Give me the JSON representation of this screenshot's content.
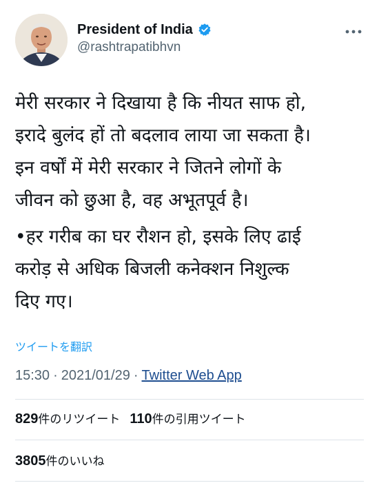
{
  "author": {
    "display_name": "President of India",
    "handle": "@rashtrapatibhvn",
    "avatar_icon": "portrait-avatar",
    "verified_icon": "verified-badge-icon",
    "verified_color": "#1d9bf0"
  },
  "menu": {
    "icon": "more-horizontal-icon"
  },
  "tweet": {
    "paragraphs": [
      "मेरी सरकार ने दिखाया है कि नीयत साफ हो,\nइरादे बुलंद हों तो बदलाव लाया जा सकता है।\nइन वर्षों में मेरी सरकार ने जितने लोगों के\nजीवन को छुआ है, वह अभूतपूर्व है।",
      "•हर गरीब का घर रौशन हो, इसके लिए ढाई\nकरोड़ से अधिक बिजली कनेक्शन निशुल्क\nदिए गए।"
    ],
    "translate_label": "ツイートを翻訳"
  },
  "meta": {
    "time": "15:30",
    "separator": "·",
    "date": "2021/01/29",
    "source": "Twitter Web App"
  },
  "stats": {
    "retweets_count": "829",
    "retweets_label": "件のリツイート",
    "quotes_count": "110",
    "quotes_label": "件の引用ツイート",
    "likes_count": "3805",
    "likes_label": "件のいいね"
  },
  "colors": {
    "link_blue": "#1d9bf0",
    "secondary_text": "#536471",
    "divider": "#dde3e8"
  }
}
